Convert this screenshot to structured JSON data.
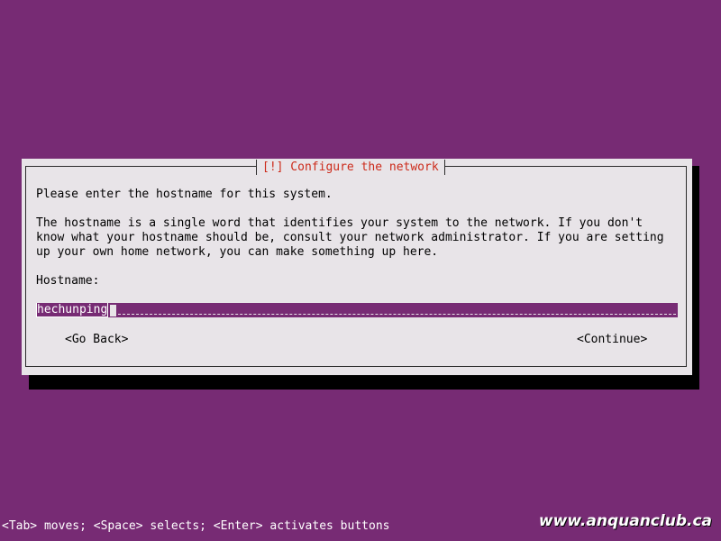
{
  "dialog": {
    "title": "[!] Configure the network",
    "prompt": "Please enter the hostname for this system.",
    "description_lines": [
      "The hostname is a single word that identifies your system to the network. If you don't",
      "know what your hostname should be, consult your network administrator. If you are setting",
      "up your own home network, you can make something up here."
    ],
    "field_label": "Hostname:",
    "hostname_value": "hechunping",
    "go_back_label": "<Go Back>",
    "continue_label": "<Continue>"
  },
  "help_line": "<Tab> moves; <Space> selects; <Enter> activates buttons",
  "watermark": "www.anquanclub.ca",
  "colors": {
    "background": "#772b74",
    "dialog": "#e8e4e8",
    "title": "#cc2a1a",
    "shadow": "#000000"
  }
}
